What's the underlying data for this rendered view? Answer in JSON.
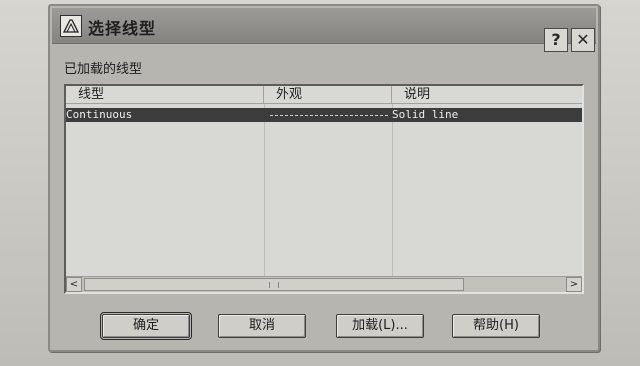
{
  "window": {
    "title": "选择线型",
    "help_glyph": "?",
    "close_glyph": "✕"
  },
  "section_label": "已加载的线型",
  "table": {
    "columns": [
      "线型",
      "外观",
      "说明"
    ],
    "rows": [
      {
        "name": "Continuous",
        "description": "Solid line",
        "selected": true
      }
    ]
  },
  "scroll": {
    "left_arrow": "<",
    "right_arrow": ">"
  },
  "buttons": {
    "ok": "确定",
    "cancel": "取消",
    "load": "加载(L)...",
    "help": "帮助(H)"
  },
  "icons": [
    "app-icon",
    "help-icon",
    "close-icon",
    "scroll-left-icon",
    "scroll-right-icon"
  ]
}
